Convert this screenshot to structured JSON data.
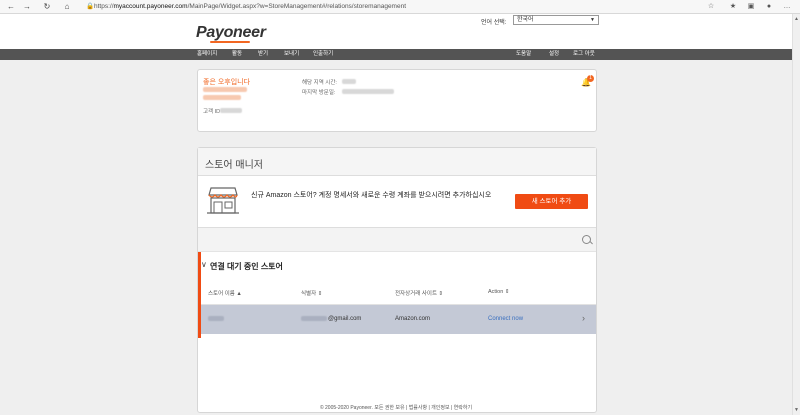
{
  "browser": {
    "url_prefix": "https://",
    "url_domain": "myaccount.payoneer.com",
    "url_path": "/MainPage/Widget.aspx?w=StoreManagement#/relations/storemanagement"
  },
  "header": {
    "logo_text": "Payoneer",
    "language_label": "언어 선택:",
    "language_value": "한국어"
  },
  "nav": {
    "left": [
      "홈페이지",
      "활동",
      "받기",
      "보내기",
      "인출하기"
    ],
    "right": [
      "도움말",
      "설정",
      "로그 아웃"
    ]
  },
  "account": {
    "greeting": "좋은 오후입니다",
    "customer_id_label": "고객 ID",
    "time_zone_label": "해당 지역 시간:",
    "last_visit_label": "마지막 방문일:",
    "notification_count": "1"
  },
  "store_manager": {
    "title": "스토어 매니저",
    "promo_text": "신규 Amazon 스토어? 계정 명세서와 새로운 수령 계좌를 받으시려면 추가하십시오",
    "new_store_button": "새 스토어 추가",
    "pending_title": "연결 대기 중인 스토어",
    "columns": [
      "스토어 이름 ▲",
      "식별자 ⇕",
      "전자상거래 사이트 ⇕",
      "Action ⇕"
    ],
    "rows": [
      {
        "identifier": "@gmail.com",
        "marketplace": "Amazon.com",
        "action": "Connect now"
      }
    ]
  },
  "footer": {
    "text": "© 2005-2020 Payoneer. 모든 권한 보유 | 법률사항 | 개인정보 | 연락하기"
  }
}
